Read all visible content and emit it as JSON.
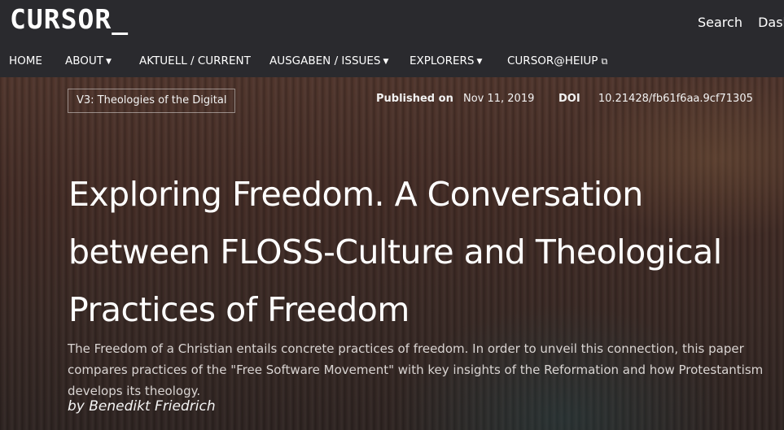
{
  "site": {
    "logo": "CURSOR_",
    "top_links": [
      "Search",
      "Dash"
    ]
  },
  "nav": [
    {
      "label": "HOME",
      "has_menu": false,
      "external": false
    },
    {
      "label": "ABOUT",
      "has_menu": true,
      "external": false
    },
    {
      "label": "AKTUELL / CURRENT",
      "has_menu": false,
      "external": false
    },
    {
      "label": "AUSGABEN / ISSUES",
      "has_menu": true,
      "external": false
    },
    {
      "label": "EXPLORERS",
      "has_menu": true,
      "external": false
    },
    {
      "label": "CURSOR@HEIUP",
      "has_menu": false,
      "external": true
    }
  ],
  "article": {
    "issue": "V3: Theologies of the Digital",
    "published_label": "Published on",
    "published_date": "Nov 11, 2019",
    "doi_label": "DOI",
    "doi": "10.21428/fb61f6aa.9cf71305",
    "title": "Exploring Freedom. A Conversation between FLOSS-Culture and Theological Practices of Freedom",
    "abstract": "The Freedom of a Christian entails concrete practices of freedom. In order to unveil this connection, this paper compares practices of the \"Free Software Movement\" with key insights of the Reformation and how Protestantism develops its theology.",
    "byline": "by Benedikt Friedrich"
  },
  "colors": {
    "header_bg": "#2a2a2e",
    "text": "#ffffff",
    "abstract_text": "#d9d4d2"
  }
}
